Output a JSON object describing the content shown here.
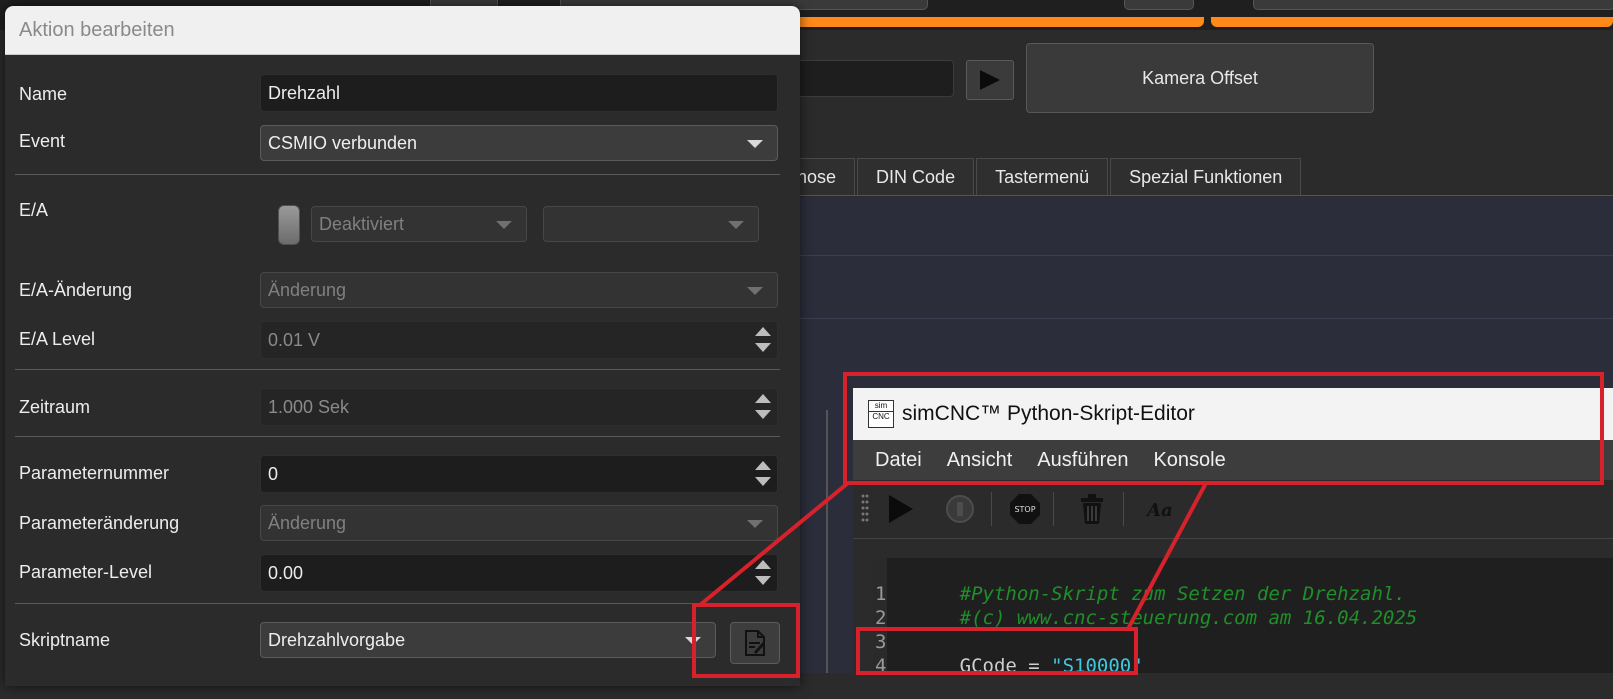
{
  "dialog": {
    "title": "Aktion bearbeiten",
    "labels": {
      "name": "Name",
      "event": "Event",
      "ea": "E/A",
      "ea_change": "E/A-Änderung",
      "ea_level": "E/A Level",
      "period": "Zeitraum",
      "param_number": "Parameternummer",
      "param_change": "Parameteränderung",
      "param_level": "Parameter-Level",
      "script_name": "Skriptname"
    },
    "values": {
      "name": "Drehzahl",
      "event": "CSMIO verbunden",
      "ea_select": "Deaktiviert",
      "ea_select2": "",
      "ea_change": "Änderung",
      "ea_level": "0.01 V",
      "period": "1.000 Sek",
      "param_number": "0",
      "param_change": "Änderung",
      "param_level": "0.00",
      "script_name": "Drehzahlvorgabe"
    }
  },
  "background": {
    "camera_button": "Kamera Offset",
    "tabs": [
      "nose",
      "DIN Code",
      "Tastermenü",
      "Spezial Funktionen"
    ]
  },
  "editor": {
    "logo_top": "sim",
    "logo_bottom": "CNC",
    "title": "simCNC™ Python-Skript-Editor",
    "menu": [
      "Datei",
      "Ansicht",
      "Ausführen",
      "Konsole"
    ],
    "toolbar_icons": [
      "run-icon",
      "stop-circle-icon",
      "stop-sign-icon",
      "trash-icon",
      "font-icon"
    ],
    "stop_sign_text": "STOP",
    "font_icon_text": "Aa",
    "code": {
      "line_numbers": [
        "1",
        "2",
        "3",
        "4"
      ],
      "line1": "#Python-Skript zum Setzen der Drehzahl.",
      "line2": "#(c) www.cnc-steuerung.com am 16.04.2025",
      "line3": "",
      "line4_var": "GCode",
      "line4_op": " = ",
      "line4_str": "\"S10000\""
    }
  },
  "colors": {
    "accent_orange": "#ff8a1a",
    "annotation_red": "#d8222b",
    "comment_green": "#1f8f2a",
    "string_cyan": "#3fc7df"
  }
}
